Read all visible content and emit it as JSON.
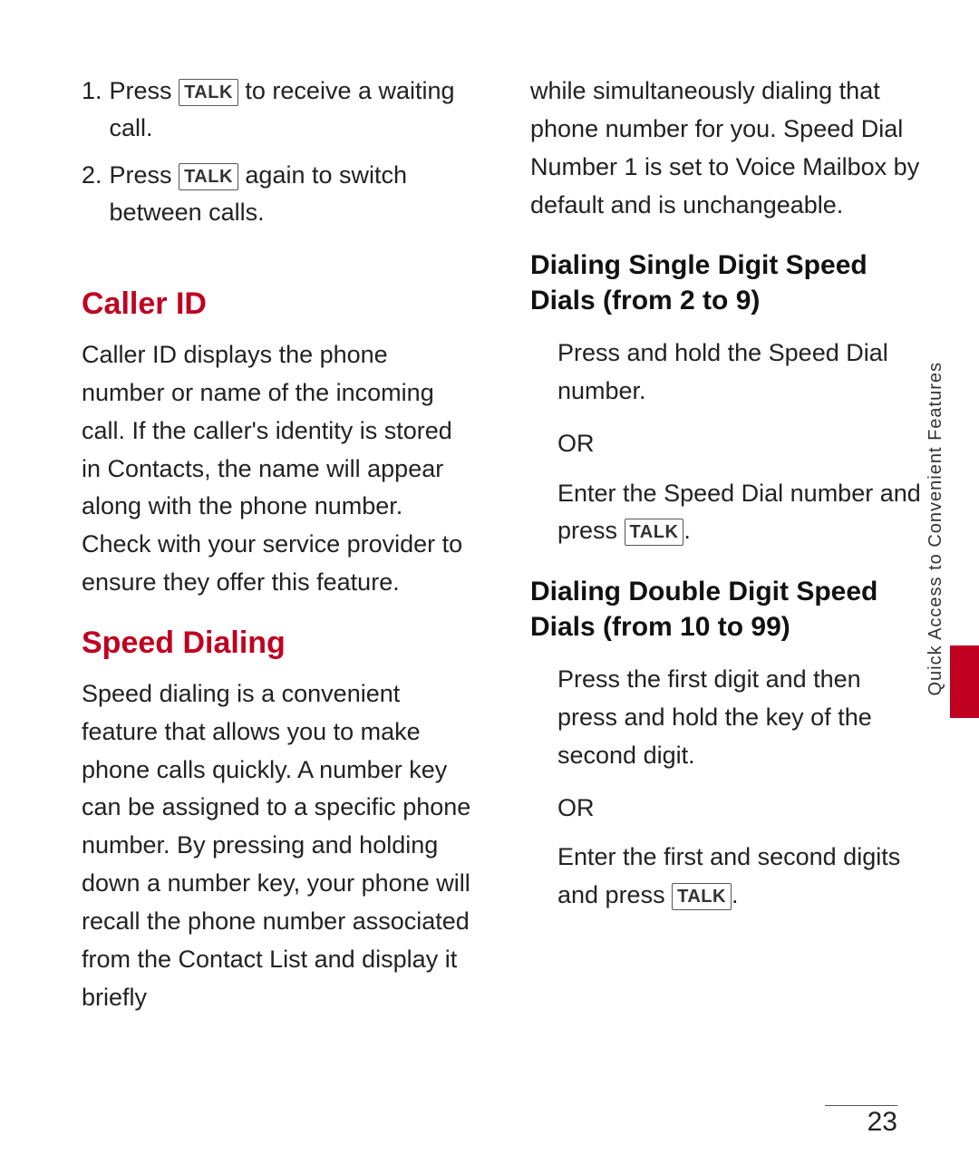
{
  "page": {
    "number": "23"
  },
  "sidetab": {
    "label": "Quick Access to Convenient Features"
  },
  "left": {
    "numbered_items": [
      {
        "num": "1.",
        "text_before": "Press",
        "badge": "TALK",
        "text_after": "to receive a waiting call."
      },
      {
        "num": "2.",
        "text_before": "Press",
        "badge": "TALK",
        "text_after": "again to switch between calls."
      }
    ],
    "caller_id_heading": "Caller ID",
    "caller_id_body": "Caller ID displays the phone number or name of the incoming call. If the caller's identity is stored in Contacts, the name will appear along with the phone number. Check with your service provider to ensure they offer this feature.",
    "speed_dialing_heading": "Speed Dialing",
    "speed_dialing_body": "Speed dialing is a convenient feature that allows you to make phone calls quickly. A number key can be assigned to a specific phone number. By pressing and holding down a number key, your phone will recall the phone number associated from the Contact List and display it briefly"
  },
  "right": {
    "intro_text": "while simultaneously dialing that phone number for you. Speed Dial Number 1 is set to Voice Mailbox by default and is unchangeable.",
    "single_digit_heading": "Dialing Single Digit Speed Dials (from 2 to 9)",
    "single_digit_p1": "Press and hold the Speed Dial number.",
    "single_digit_or": "OR",
    "single_digit_p2_before": "Enter the Speed Dial number and press",
    "single_digit_p2_badge": "TALK",
    "single_digit_p2_after": ".",
    "double_digit_heading": "Dialing Double Digit Speed Dials (from 10 to 99)",
    "double_digit_p1": "Press the first digit and then press and hold the key of the second digit.",
    "double_digit_or": "OR",
    "double_digit_p2_before": "Enter the first and second digits and press",
    "double_digit_p2_badge": "TALK",
    "double_digit_p2_after": ".",
    "talk_badge_label": "TALK"
  }
}
